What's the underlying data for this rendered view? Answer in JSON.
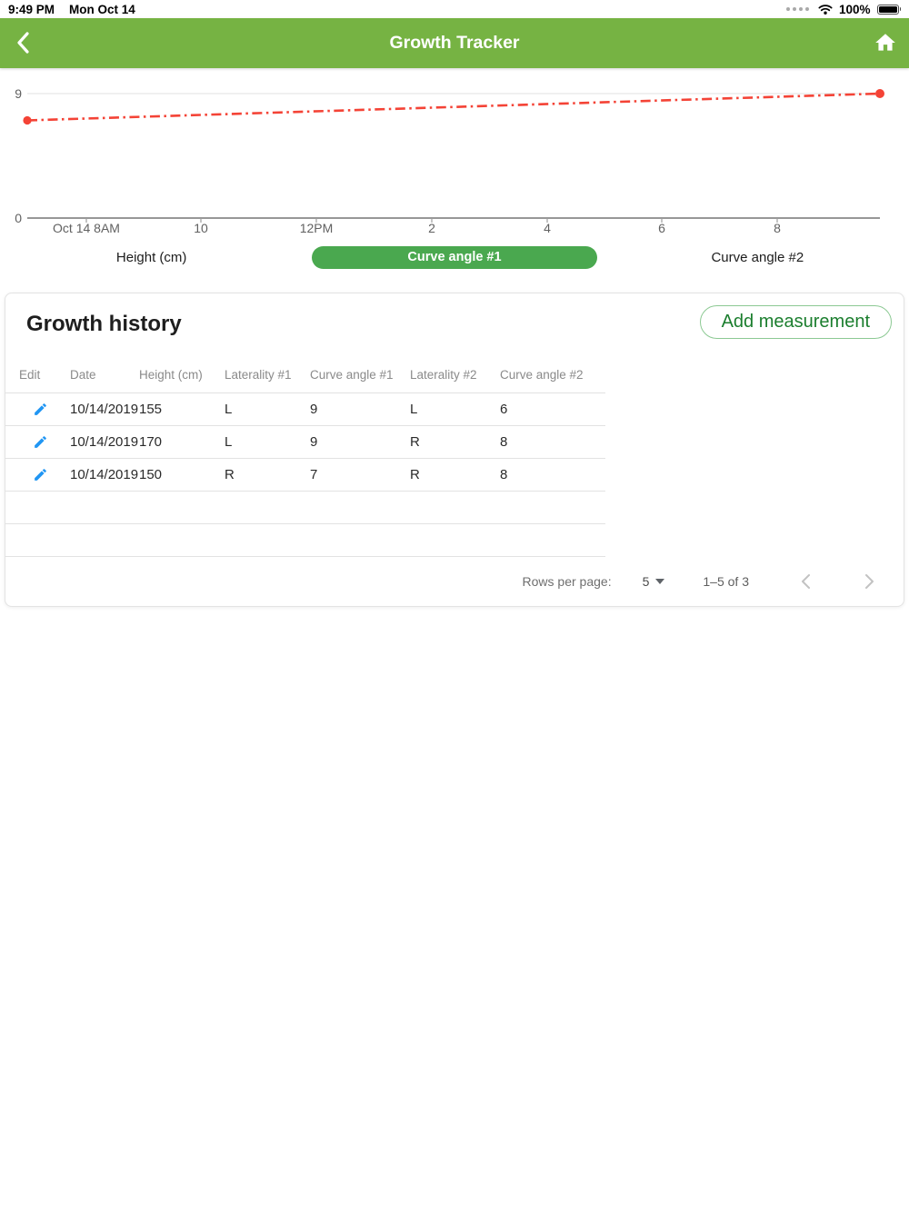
{
  "status_bar": {
    "time": "9:49 PM",
    "date": "Mon Oct 14",
    "battery_percent": "100%"
  },
  "header": {
    "title": "Growth Tracker"
  },
  "chart_data": {
    "type": "line",
    "title": "",
    "xlabel": "",
    "ylabel": "",
    "series": [
      {
        "name": "Curve angle #1",
        "color": "#f44336",
        "line_style": "dash-dot",
        "points": [
          {
            "x": "Oct 14 ~7:00AM",
            "y": 7
          },
          {
            "x": "Oct 14 ~9:47PM",
            "y": 9
          }
        ]
      }
    ],
    "x_ticks": [
      "Oct 14 8AM",
      "10",
      "12PM",
      "2",
      "4",
      "6",
      "8"
    ],
    "y_ticks": [
      "9",
      "0"
    ],
    "ylim": [
      0,
      9.6
    ],
    "grid": "single horizontal gridline at y=9",
    "legend_position": "below chart",
    "selected_series": "Curve angle #1"
  },
  "legend": {
    "items": [
      "Height (cm)",
      "Curve angle #1",
      "Curve angle #2"
    ],
    "selected": "Curve angle #1"
  },
  "history": {
    "title": "Growth history",
    "add_button": "Add measurement",
    "columns": [
      "Edit",
      "Date",
      "Height (cm)",
      "Laterality #1",
      "Curve angle #1",
      "Laterality #2",
      "Curve angle #2"
    ],
    "rows": [
      {
        "date": "10/14/2019",
        "height": "155",
        "lat1": "L",
        "angle1": "9",
        "lat2": "L",
        "angle2": "6"
      },
      {
        "date": "10/14/2019",
        "height": "170",
        "lat1": "L",
        "angle1": "9",
        "lat2": "R",
        "angle2": "8"
      },
      {
        "date": "10/14/2019",
        "height": "150",
        "lat1": "R",
        "angle1": "7",
        "lat2": "R",
        "angle2": "8"
      }
    ],
    "pagination": {
      "rows_per_page_label": "Rows per page:",
      "rows_per_page_value": "5",
      "range": "1–5 of 3"
    }
  },
  "colors": {
    "appbar_green": "#76b343",
    "chip_green": "#4aa84f",
    "button_green_text": "#1b7e2e",
    "button_green_border": "#8cc993",
    "series_red": "#f44336",
    "edit_blue": "#2196f3"
  }
}
